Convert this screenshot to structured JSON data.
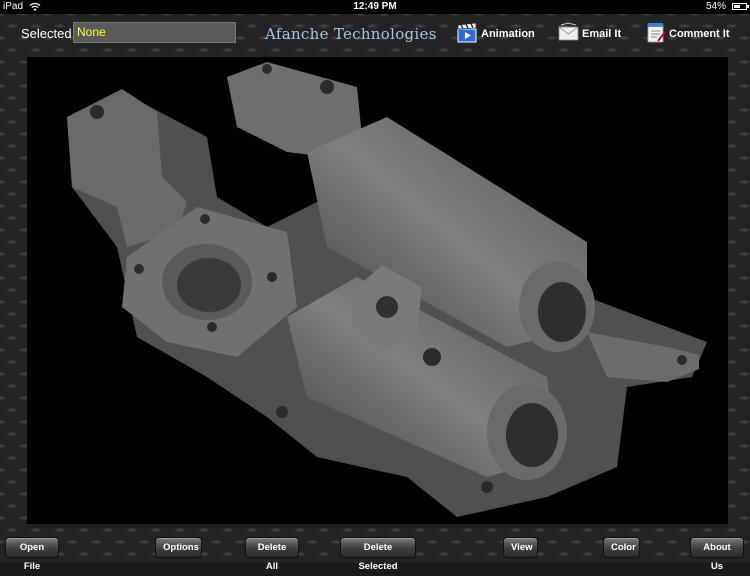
{
  "status_bar": {
    "carrier": "iPad",
    "time": "12:49 PM",
    "battery_percent": "54%",
    "battery_level": 0.54,
    "wifi_icon": "wifi-icon",
    "battery_icon": "battery-icon"
  },
  "top_toolbar": {
    "selected_label": "Selected",
    "selected_value": "None",
    "brand": "Afanche Technologies",
    "animation_label": "Animation",
    "email_label": "Email It",
    "comment_label": "Comment It",
    "icons": {
      "animation": "clapperboard-icon",
      "email": "envelope-icon",
      "comment": "notepad-icon"
    }
  },
  "viewport": {
    "background": "#000000",
    "model_color": "#6b6b6b",
    "content": "3d-model-render"
  },
  "bottom_toolbar": {
    "open_file": "Open File",
    "options": "Options",
    "delete_all": "Delete All",
    "delete_selected": "Delete Selected",
    "view": "View",
    "color": "Color",
    "about_us": "About Us"
  },
  "colors": {
    "selected_text": "#ffff3a",
    "brand_text": "#a9c3e6",
    "plate": "#232323"
  }
}
